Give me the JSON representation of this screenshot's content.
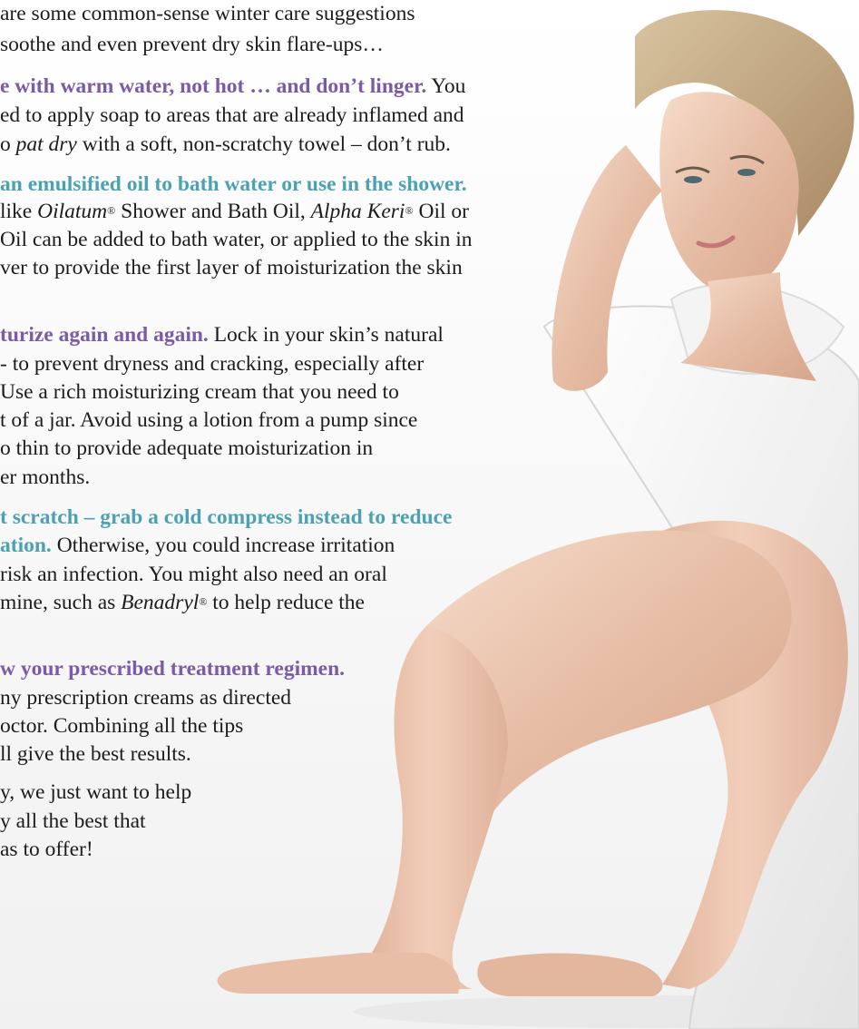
{
  "colors": {
    "heading_purple": "#7a5ba8",
    "heading_teal": "#4ca1b3",
    "body_text": "#1c1c1c",
    "background": "#ffffff"
  },
  "image": {
    "subject": "woman in white robe sitting with bare legs"
  },
  "intro": {
    "line1": "are some common-sense winter care suggestions",
    "line2": "soothe and even prevent dry skin flare-ups…"
  },
  "tip1": {
    "heading": "e with warm water, not hot … and don’t linger.",
    "line1_tail": " You",
    "line2": "ed to apply soap to areas that are already inflamed and",
    "line3_pre": "o ",
    "line3_em": "pat dry",
    "line3_post": " with a soft, non-scratchy towel – don’t rub."
  },
  "tip2": {
    "heading": "an emulsified oil to bath water or use in the shower.",
    "line2_pre": " like ",
    "line2_em1": "Oilatum",
    "reg": "®",
    "line2_mid": " Shower and Bath Oil, ",
    "line2_em2": "Alpha Keri",
    "line2_post": " Oil or",
    "line3": "Oil can be added to bath water, or applied to the skin in",
    "line4": "ver to provide the first layer of moisturization the skin"
  },
  "tip3": {
    "heading": "turize again and again.",
    "line1_tail": " Lock in your skin’s natural",
    "line2": "- to prevent dryness and cracking, especially after",
    "line3": "Use a rich moisturizing cream that you need to",
    "line4": "t of a jar. Avoid using a lotion from a pump since",
    "line5": "o thin to provide adequate moisturization in",
    "line6": "er months."
  },
  "tip4": {
    "heading1": "t scratch – grab a cold compress instead to reduce",
    "heading2": "ation.",
    "line2_tail": " Otherwise, you could increase irritation",
    "line3": "risk an infection. You might also need an oral",
    "line4_pre": "mine, such as ",
    "line4_em": "Benadryl",
    "line4_post": " to help reduce the"
  },
  "tip5": {
    "heading": "w your prescribed treatment regimen.",
    "line2": "ny prescription creams as directed",
    "line3": "octor. Combining all the tips",
    "line4": "ll give the best results."
  },
  "closing": {
    "line1": "y, we just want to help",
    "line2": "y all the best that",
    "line3": "as to offer!"
  }
}
